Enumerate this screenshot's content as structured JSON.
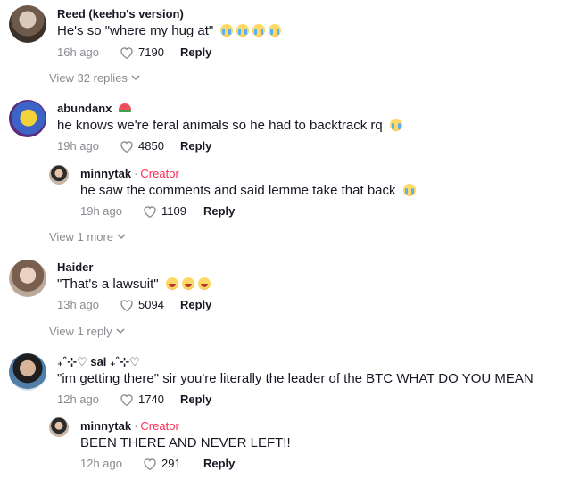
{
  "comments": [
    {
      "author": "Reed (keeho's version)",
      "text": "He's so \"where my hug at\"",
      "time": "16h ago",
      "likes": "7190",
      "reply": "Reply",
      "view_replies": "View 32 replies"
    },
    {
      "author": "abundanx",
      "text": "he knows we're feral animals so he had to backtrack rq",
      "time": "19h ago",
      "likes": "4850",
      "reply": "Reply",
      "reply_item": {
        "author": "minnytak",
        "badge": "Creator",
        "text": "he saw the comments and said lemme take that back",
        "time": "19h ago",
        "likes": "1109",
        "reply": "Reply"
      },
      "view_more": "View 1 more"
    },
    {
      "author": "Haider",
      "text": "\"That's a lawsuit\"",
      "time": "13h ago",
      "likes": "5094",
      "reply": "Reply",
      "view_replies": "View 1 reply"
    },
    {
      "author": "₊˚⊹♡ sai ₊˚⊹♡",
      "text": "\"im getting there\" sir you're literally the leader of the BTC WHAT DO YOU MEAN",
      "time": "12h ago",
      "likes": "1740",
      "reply": "Reply",
      "reply_item": {
        "author": "minnytak",
        "badge": "Creator",
        "text": "BEEN THERE AND NEVER LEFT!!",
        "time": "12h ago",
        "likes": "291",
        "reply": "Reply"
      }
    }
  ],
  "icons": {
    "like": "heart-outline-icon",
    "expand": "chevron-down-icon"
  },
  "colors": {
    "creator": "#fe2c55",
    "muted": "#8a8b91",
    "text": "#161823"
  }
}
